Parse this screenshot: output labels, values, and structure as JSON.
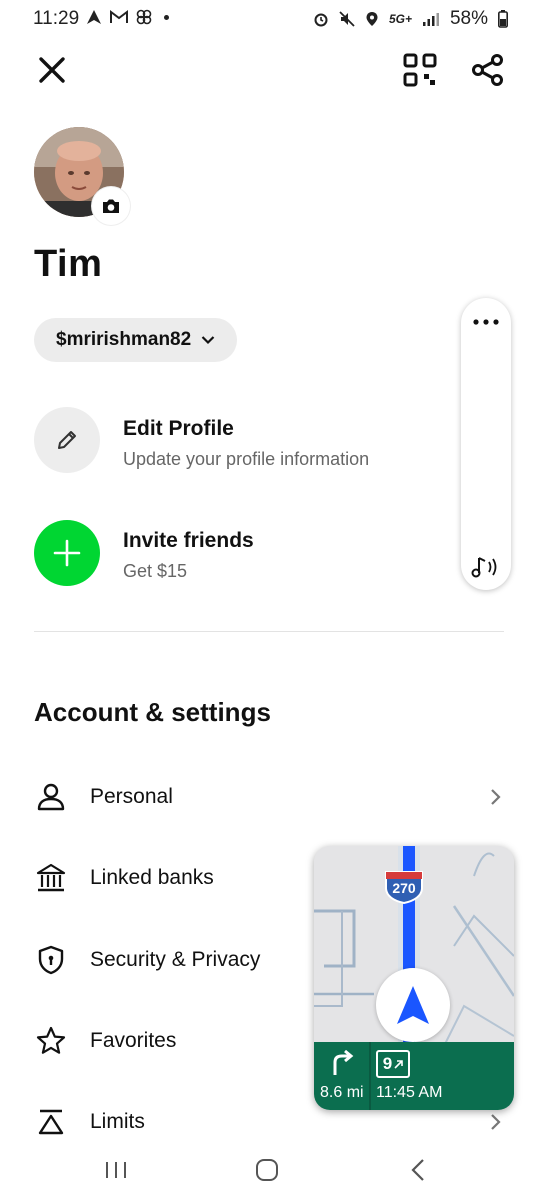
{
  "status_bar": {
    "time": "11:29",
    "network": "5G+",
    "battery": "58%"
  },
  "profile": {
    "name": "Tim",
    "cashtag": "$mririshman82"
  },
  "actions": [
    {
      "title": "Edit Profile",
      "subtitle": "Update your profile information",
      "icon": "pencil-icon"
    },
    {
      "title": "Invite friends",
      "subtitle": "Get $15",
      "icon": "plus-icon"
    }
  ],
  "settings": {
    "title": "Account & settings",
    "items": [
      {
        "label": "Personal",
        "icon": "person-icon"
      },
      {
        "label": "Linked banks",
        "icon": "bank-icon"
      },
      {
        "label": "Security & Privacy",
        "icon": "shield-icon"
      },
      {
        "label": "Favorites",
        "icon": "star-icon"
      },
      {
        "label": "Limits",
        "icon": "limits-icon"
      }
    ]
  },
  "map_overlay": {
    "highway_shield": "270",
    "exit": "9",
    "distance": "8.6 mi",
    "eta": "11:45 AM"
  },
  "colors": {
    "accent_green": "#00D632",
    "nav_green": "#0b6e4f",
    "route_blue": "#1a56ff"
  }
}
